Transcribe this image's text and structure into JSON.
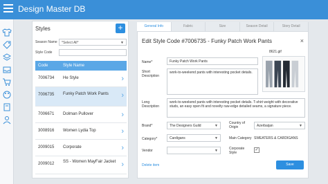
{
  "app": {
    "title": "Design Master DB"
  },
  "styles_panel": {
    "title": "Styles",
    "add_label": "+",
    "season_label": "Season Name",
    "season_value": "*Select All*",
    "style_code_label": "Style Code",
    "style_code_value": "",
    "columns": [
      "Code",
      "Style Name"
    ],
    "rows": [
      {
        "code": "7006734",
        "name": "He Style"
      },
      {
        "code": "7006735",
        "name": "Funky Patch Work Pants"
      },
      {
        "code": "7006671",
        "name": "Dolman Pullover"
      },
      {
        "code": "3008916",
        "name": "Women Lydia Top"
      },
      {
        "code": "2009015",
        "name": "Corporate"
      },
      {
        "code": "2009012",
        "name": "SS - Women MayFair Jacket"
      }
    ]
  },
  "tabs": [
    "General Info",
    "Fabric",
    "Size",
    "Season Detail",
    "Story Detail"
  ],
  "form": {
    "title": "Edit Style Code #7006735 - Funky Patch Work Pants",
    "close_label": "×",
    "name_label": "Name*",
    "name_value": "Funky Patch Work Pants",
    "short_desc_label": "Short Description",
    "short_desc_value": "work-to-weekend pants with interesting pocket details.",
    "long_desc_label": "Long Description",
    "long_desc_value": "work-to-weekend pants with interesting pocket details. T-shirt weight with decorative studs, an easy open fit and novelty raw-edge detailed seams, a signature piece.",
    "image_file": "8621.gif",
    "brand_label": "Brand*",
    "brand_value": "The Designers Guild",
    "country_label": "Country of Origin",
    "country_value": "Azerbaijan",
    "category_label": "Category*",
    "category_value": "Cardigans",
    "main_category_label": "Main Category",
    "main_category_value": "SWEATERS & CARDIGANS",
    "vendor_label": "Vendor",
    "vendor_value": "",
    "corporate_label": "Corporate Style",
    "corporate_checked": "✓",
    "delete_label": "Delete item",
    "save_label": "Save"
  },
  "colors": {
    "primary": "#3a8fd8",
    "header": "#5aa7e6",
    "accent": "#2d8fe0"
  }
}
